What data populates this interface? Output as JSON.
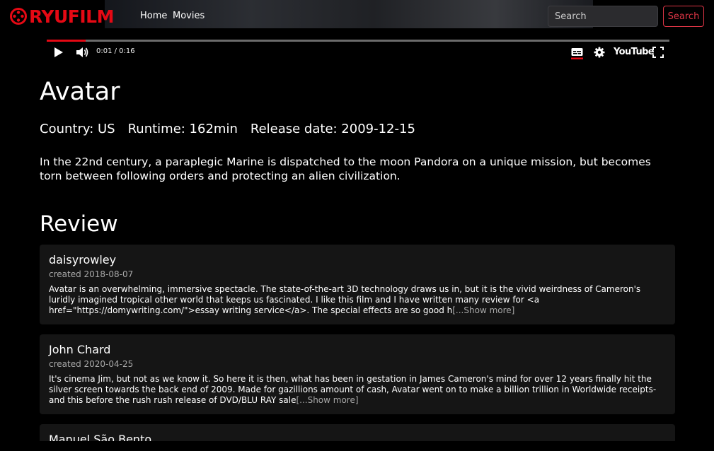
{
  "nav": {
    "brand": "RYUFILM",
    "links": [
      {
        "label": "Home"
      },
      {
        "label": "Movies"
      }
    ],
    "search": {
      "placeholder": "Search",
      "value": "",
      "button": "Search"
    }
  },
  "player": {
    "time": "0:01 / 0:16",
    "progress": 0.0625,
    "brand": "YouTube",
    "icons": [
      "play-icon",
      "volume-icon",
      "subtitles-icon",
      "settings-icon",
      "fullscreen-icon"
    ]
  },
  "movie": {
    "title": "Avatar",
    "country": "Country: US",
    "runtime": "Runtime: 162min",
    "release": "Release date: 2009-12-15",
    "overview": "In the 22nd century, a paraplegic Marine is dispatched to the moon Pandora on a unique mission, but becomes torn between following orders and protecting an alien civilization."
  },
  "reviews": {
    "heading": "Review",
    "items": [
      {
        "author": "daisyrowley",
        "created": "created 2018-08-07",
        "content": "Avatar is an overwhelming, immersive spectacle. The state-of-the-art 3D technology draws us in, but it is the vivid weirdness of Cameron's luridly imagined tropical other world that keeps us fascinated. I like this film and I have written many review for <a href=\"https://domywriting.com/\">essay writing service</a>. The special effects are so good h",
        "more": "[...Show more]"
      },
      {
        "author": "John Chard",
        "created": "created 2020-04-25",
        "content": "It's cinema Jim, but not as we know it. So here it is then, what has been in gestation in James Cameron's mind for over 12 years finally hit the silver screen towards the back end of 2009. Made for gazillions amount of cash, Avatar went on to make a billion trillion in Worldwide receipts-and this before the rush rush release of DVD/BLU RAY sale",
        "more": "[...Show more]"
      },
      {
        "author": "Manuel São Bento",
        "created": "",
        "content": "",
        "more": ""
      }
    ]
  },
  "colors": {
    "accent": "#e50914",
    "danger": "#dc3545",
    "card": "#151515",
    "muted": "#a8a8a8"
  }
}
